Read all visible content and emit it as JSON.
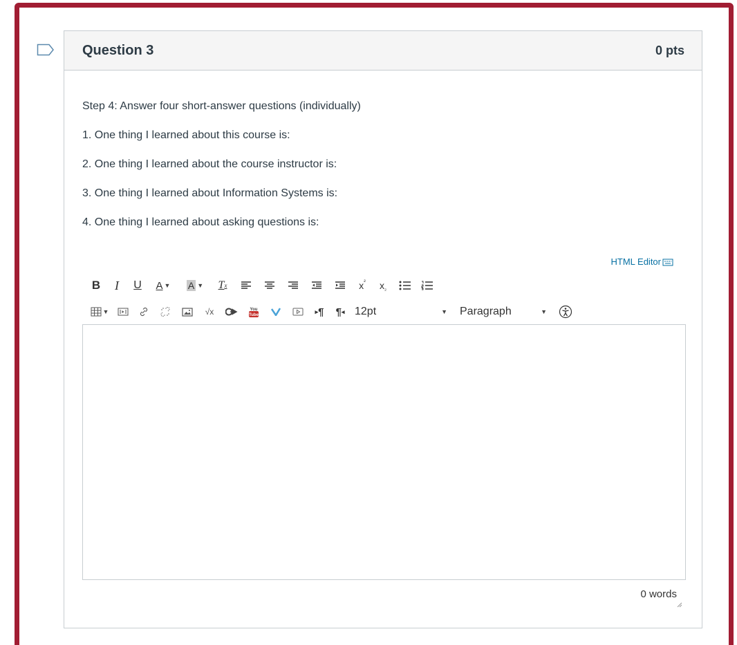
{
  "question": {
    "title": "Question 3",
    "points": "0 pts",
    "lines": [
      "Step 4: Answer four short-answer questions (individually)",
      "1. One thing I learned about this course is:",
      "2. One thing I learned about the course instructor is:",
      "3. One thing I learned about Information Systems is:",
      "4. One thing I learned about asking questions is:"
    ]
  },
  "editor": {
    "html_editor_label": "HTML Editor",
    "font_size": "12pt",
    "block_format": "Paragraph",
    "answer_text": "",
    "word_count": "0 words"
  },
  "colors": {
    "frame": "#a11d33",
    "link": "#0770a3",
    "header_bg": "#f5f5f5"
  }
}
